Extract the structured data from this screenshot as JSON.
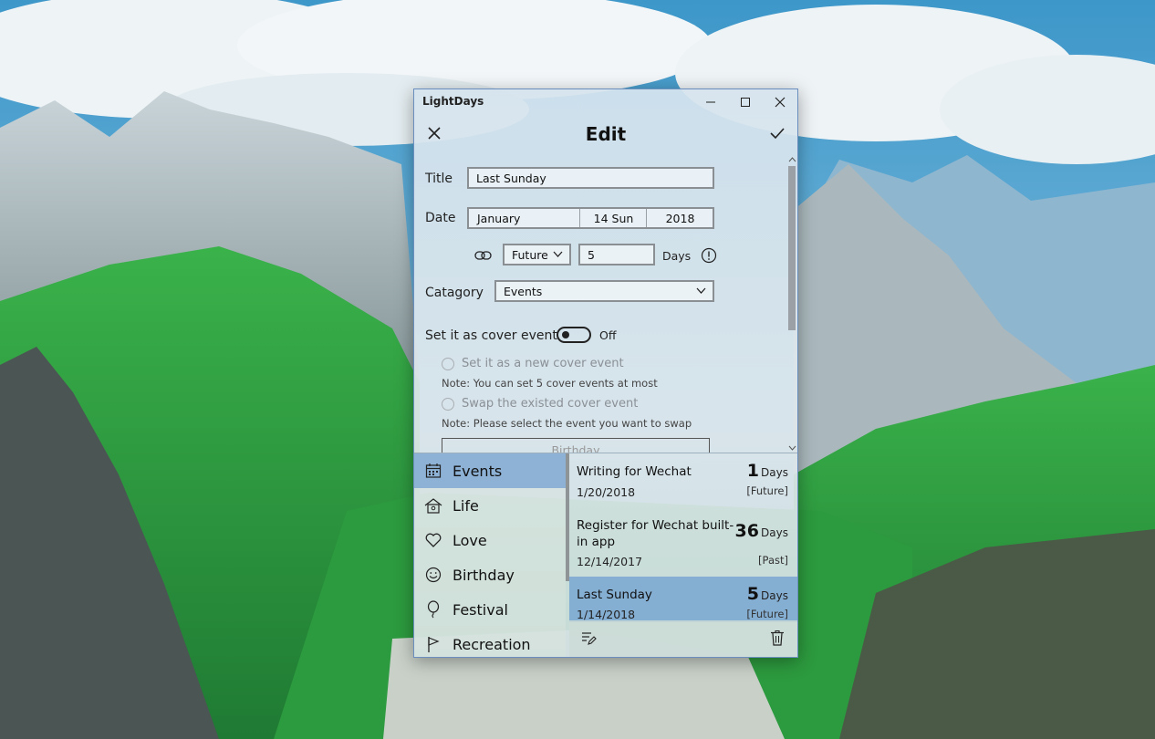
{
  "window": {
    "app_title": "LightDays",
    "minimize_glyph": "minimize-icon",
    "maximize_glyph": "maximize-icon",
    "close_glyph": "close-icon"
  },
  "header": {
    "title": "Edit",
    "cancel_icon": "close-icon",
    "confirm_icon": "checkmark-icon"
  },
  "form": {
    "title_label": "Title",
    "title_value": "Last Sunday",
    "date_label": "Date",
    "date_month": "January",
    "date_day": "14 Sun",
    "date_year": "2018",
    "direction_value": "Future",
    "days_count": "5",
    "days_unit": "Days",
    "category_label": "Catagory",
    "category_value": "Events",
    "cover_label": "Set it as cover event",
    "cover_toggle_state": "Off",
    "radio_new": "Set it as a new cover event",
    "note_new": "Note: You can set 5 cover events at most",
    "radio_swap": "Swap the existed cover event",
    "note_swap": "Note: Please select the event you want to swap",
    "swap_list_first": "Birthday"
  },
  "categories": [
    {
      "label": "Events",
      "icon": "calendar-icon",
      "selected": true
    },
    {
      "label": "Life",
      "icon": "home-icon",
      "selected": false
    },
    {
      "label": "Love",
      "icon": "heart-icon",
      "selected": false
    },
    {
      "label": "Birthday",
      "icon": "smiley-icon",
      "selected": false
    },
    {
      "label": "Festival",
      "icon": "balloon-icon",
      "selected": false
    },
    {
      "label": "Recreation",
      "icon": "flag-icon",
      "selected": false
    }
  ],
  "events": [
    {
      "name": "Writing for Wechat",
      "date": "1/20/2018",
      "count": "1",
      "unit": "Days",
      "tag": "[Future]",
      "selected": false
    },
    {
      "name": "Register for Wechat built-in app",
      "date": "12/14/2017",
      "count": "36",
      "unit": "Days",
      "tag": "[Past]",
      "selected": false
    },
    {
      "name": "Last Sunday",
      "date": "1/14/2018",
      "count": "5",
      "unit": "Days",
      "tag": "[Future]",
      "selected": true
    }
  ],
  "bottom_bar": {
    "left_icon": "edit-list-icon",
    "right_icon": "trash-icon"
  },
  "colors": {
    "accent": "#74a2d2",
    "window_border": "#6a8fbf"
  }
}
